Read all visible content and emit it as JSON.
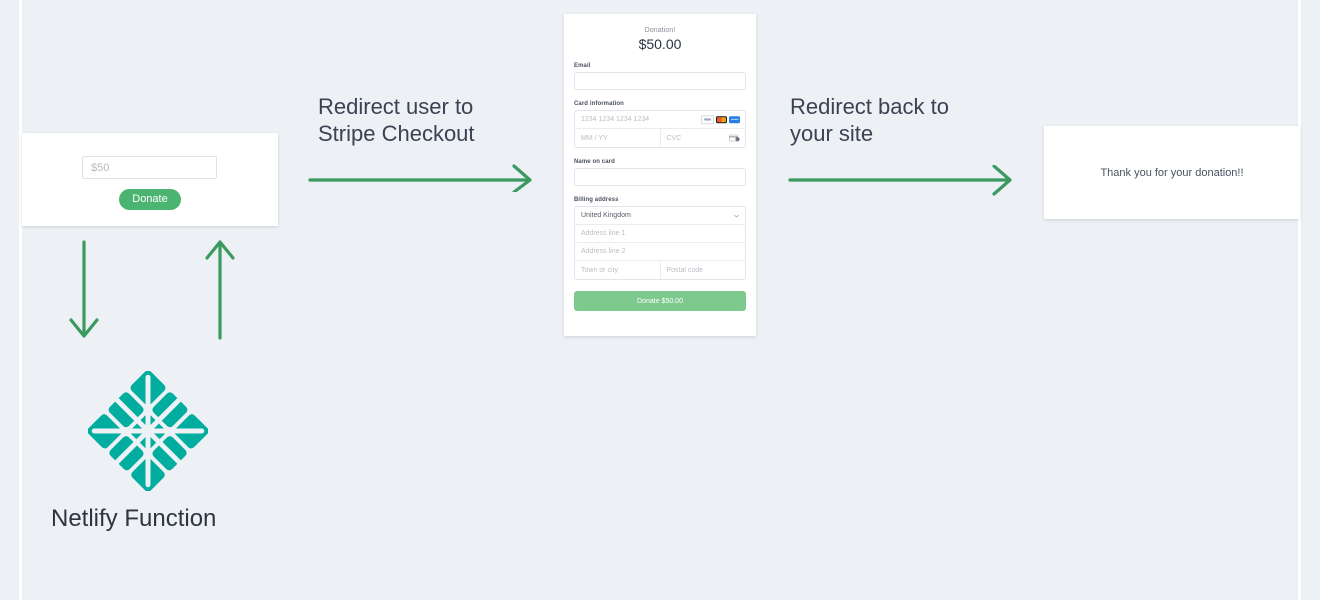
{
  "diagram": {
    "background_color": "#edf1f5",
    "accent_green": "#3a9a5f",
    "button_green": "#4cb471",
    "stripe_button_green": "#7dc98e",
    "netlify_teal": "#00ad9f",
    "text_dark": "#3b4252"
  },
  "donate_widget": {
    "amount_placeholder": "$50",
    "amount_value": "",
    "donate_button_label": "Donate"
  },
  "stripe_checkout": {
    "heading": "Donation!",
    "amount": "$50.00",
    "email_label": "Email",
    "email_value": "",
    "email_placeholder": "",
    "card_information_label": "Card information",
    "card_number_placeholder": "1234 1234 1234 1234",
    "card_expiry_placeholder": "MM / YY",
    "card_cvc_placeholder": "CVC",
    "name_on_card_label": "Name on card",
    "name_on_card_value": "",
    "billing_address_label": "Billing address",
    "country_value": "United Kingdom",
    "address_line_1_placeholder": "Address line 1",
    "address_line_2_placeholder": "Address line 2",
    "town_or_city_placeholder": "Town or city",
    "postal_code_placeholder": "Postal code",
    "submit_label": "Donate $50.00",
    "card_brands": [
      "visa-icon",
      "mastercard-icon",
      "amex-icon"
    ],
    "cvc_hint_icon": "card-cvc-icon",
    "country_select_icon": "chevron-down-icon"
  },
  "thankyou_page": {
    "message": "Thank you for your donation!!"
  },
  "flow": {
    "label_redirect_to_stripe": "Redirect user to\nStripe Checkout",
    "label_redirect_back": "Redirect back to\nyour site",
    "arrow_to_stripe_icon": "arrow-right-icon",
    "arrow_to_site_icon": "arrow-right-icon",
    "arrow_down_icon": "arrow-down-icon",
    "arrow_up_icon": "arrow-up-icon"
  },
  "netlify": {
    "label": "Netlify Function",
    "logo_icon": "netlify-logo-icon"
  }
}
